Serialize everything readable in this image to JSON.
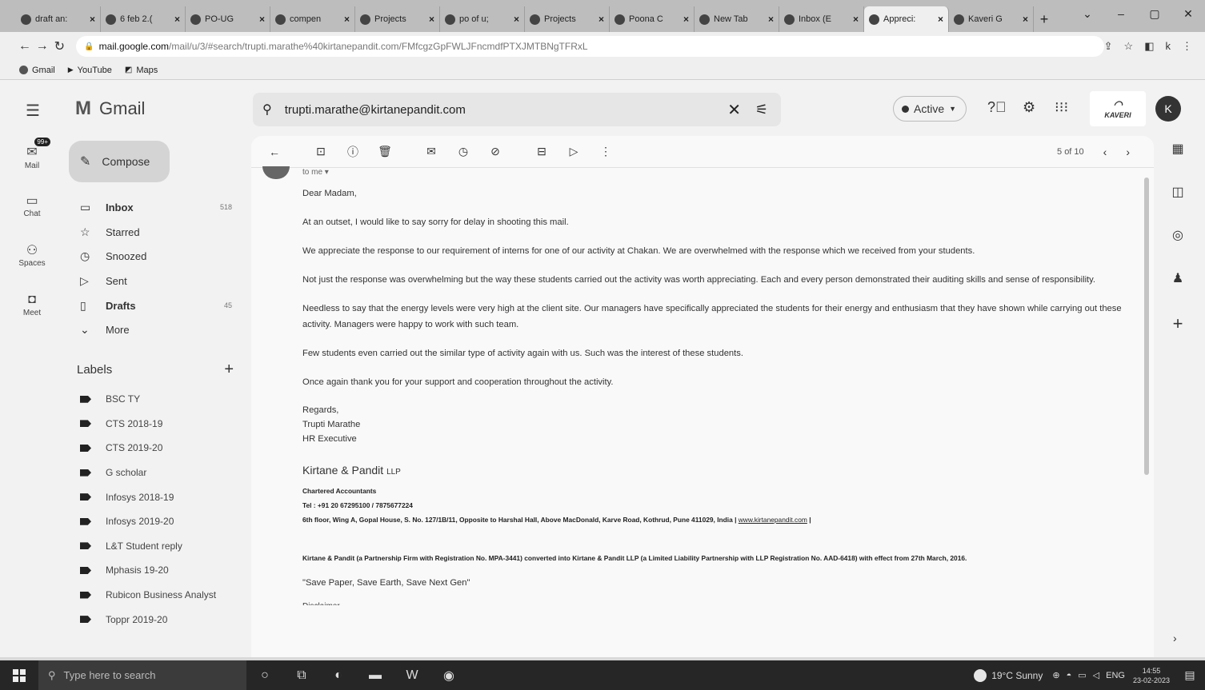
{
  "browser": {
    "tabs": [
      {
        "title": "draft an:",
        "active": false
      },
      {
        "title": "6 feb 2.(",
        "active": false
      },
      {
        "title": "PO-UG",
        "active": false
      },
      {
        "title": "compen",
        "active": false
      },
      {
        "title": "Projects",
        "active": false
      },
      {
        "title": "po of u;",
        "active": false
      },
      {
        "title": "Projects",
        "active": false
      },
      {
        "title": "Poona C",
        "active": false
      },
      {
        "title": "New Tab",
        "active": false
      },
      {
        "title": "Inbox (E",
        "active": false
      },
      {
        "title": "Appreci:",
        "active": true
      },
      {
        "title": "Kaveri G",
        "active": false
      }
    ],
    "url_domain": "mail.google.com",
    "url_path": "/mail/u/3/#search/trupti.marathe%40kirtanepandit.com/FMfcgzGpFWLJFncmdfPTXJMTBNgTFRxL",
    "bookmarks": [
      "Gmail",
      "YouTube",
      "Maps"
    ]
  },
  "gmail": {
    "product_name": "Gmail",
    "search_value": "trupti.marathe@kirtanepandit.com",
    "status": "Active",
    "avatar_letter": "K",
    "org_logo_text": "KAVERI",
    "rail": [
      {
        "label": "Mail",
        "icon": "mail-icon",
        "badge": "99+"
      },
      {
        "label": "Chat",
        "icon": "chat-icon"
      },
      {
        "label": "Spaces",
        "icon": "spaces-icon"
      },
      {
        "label": "Meet",
        "icon": "meet-icon"
      }
    ],
    "compose_label": "Compose",
    "nav": [
      {
        "label": "Inbox",
        "count": "518",
        "icon": "inbox-icon",
        "glyph": "▭",
        "bold": true
      },
      {
        "label": "Starred",
        "count": "",
        "icon": "star-icon",
        "glyph": "☆",
        "bold": false
      },
      {
        "label": "Snoozed",
        "count": "",
        "icon": "clock-icon",
        "glyph": "◷",
        "bold": false
      },
      {
        "label": "Sent",
        "count": "",
        "icon": "send-icon",
        "glyph": "▷",
        "bold": false
      },
      {
        "label": "Drafts",
        "count": "45",
        "icon": "draft-icon",
        "glyph": "▯",
        "bold": true
      },
      {
        "label": "More",
        "count": "",
        "icon": "chevron-down-icon",
        "glyph": "⌄",
        "bold": false
      }
    ],
    "labels_header": "Labels",
    "labels": [
      "BSC TY",
      "CTS 2018-19",
      "CTS 2019-20",
      "G scholar",
      "Infosys 2018-19",
      "Infosys 2019-20",
      "L&T Student reply",
      "Mphasis 19-20",
      "Rubicon Business Analyst",
      "Toppr 2019-20"
    ],
    "pager": "5 of 10"
  },
  "email": {
    "to_me": "to me ▾",
    "paragraphs": [
      "Dear Madam,",
      "At an outset, I would like to say sorry for delay in shooting this mail.",
      "We appreciate the response to our requirement of interns for one of our activity at Chakan. We are overwhelmed with the response which we received from your students.",
      "Not just the response was overwhelming but the way these students carried out the activity was worth appreciating. Each and every person demonstrated their auditing skills and sense of responsibility.",
      "Needless to say that the energy levels were very high at the client site. Our managers have specifically appreciated the students for their energy and enthusiasm that they have shown while carrying out these activity. Managers were happy to work with such team.",
      "Few students even carried out the similar type of activity again with us. Such was the interest of these students.",
      "Once again thank you for your support and cooperation throughout the activity."
    ],
    "regards": "Regards,",
    "sender_name": "Trupti Marathe",
    "sender_title": "HR Executive",
    "firm_name": "Kirtane & Pandit",
    "firm_suffix": "LLP",
    "firm_type": "Chartered Accountants",
    "firm_tel": "Tel : +91 20 67295100 / 7875677224",
    "firm_address": "6th floor, Wing A, Gopal House, S. No. 127/1B/11, Opposite to Harshal Hall, Above MacDonald, Karve Road, Kothrud, Pune 411029, India | ",
    "firm_website": "www.kirtanepandit.com",
    "firm_address_end": " |",
    "registration_note": "Kirtane & Pandit (a Partnership Firm with Registration No. MPA-3441) converted into Kirtane & Pandit LLP (a Limited Liability Partnership with LLP Registration No. AAD-6418) with effect from 27th March, 2016.",
    "tagline": "\"Save Paper, Save Earth, Save Next Gen\"",
    "disclaimer": "Disclaimer"
  },
  "taskbar": {
    "search_placeholder": "Type here to search",
    "weather": "19°C Sunny",
    "language": "ENG",
    "time": "14:55",
    "date": "23-02-2023"
  }
}
